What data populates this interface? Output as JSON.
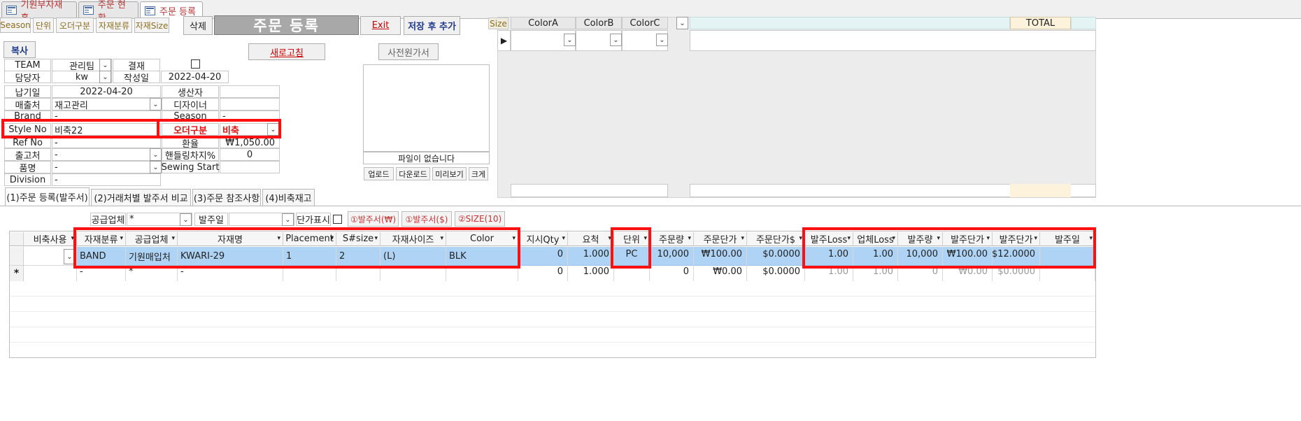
{
  "doc_tabs": [
    "기원부자재 홈",
    "주문 현황",
    "주문 등록"
  ],
  "toolbar": {
    "buttons": [
      "Season",
      "단위",
      "오더구분",
      "자재분류",
      "자재Size"
    ],
    "delete": "삭제",
    "title": "주문 등록",
    "exit": "Exit",
    "save_add": "저장 후 추가"
  },
  "copy_button": "복사",
  "refresh_button": "새로고침",
  "preview": {
    "button": "사전원가서",
    "empty": "파일이 없습니다",
    "actions": [
      "업로드",
      "다운로드",
      "미리보기",
      "크게"
    ]
  },
  "form": {
    "team_label": "TEAM",
    "team": "관리팀",
    "approval_label": "결재",
    "manager_label": "담당자",
    "manager": "kw",
    "created_label": "작성일",
    "created": "2022-04-20",
    "due_label": "납기일",
    "due": "2022-04-20",
    "producer_label": "생산자",
    "producer": "",
    "seller_label": "매출처",
    "seller": "재고관리",
    "designer_label": "디자이너",
    "designer": "",
    "brand_label": "Brand",
    "brand": "-",
    "season_label": "Season",
    "season": "-",
    "style_label": "Style No",
    "style": "비축22",
    "order_type_label": "오더구분",
    "order_type": "비축",
    "ref_label": "Ref No",
    "ref": "-",
    "exchange_label": "환율",
    "exchange": "₩1,050.00",
    "warehouse_label": "출고처",
    "warehouse": "-",
    "handling_label": "핸들링차지%",
    "handling": "0",
    "item_label": "품명",
    "item": "-",
    "sewing_label": "Sewing Start",
    "sewing": "",
    "division_label": "Division",
    "division": "-"
  },
  "size_panel": {
    "size": "Size",
    "colors": [
      "ColorA",
      "ColorB",
      "ColorC"
    ],
    "total": "TOTAL"
  },
  "subtabs": [
    "(1)주문 등록(발주서)",
    "(2)거래처별 발주서 비교",
    "(3)주문 참조사항",
    "(4)비축재고"
  ],
  "filter": {
    "supplier_label": "공급업체",
    "supplier": "*",
    "order_date_label": "발주일",
    "order_date": "",
    "price_show": "단가표시",
    "buttons": [
      "①발주서(₩)",
      "①발주서($)",
      "②SIZE(10)"
    ]
  },
  "grid": {
    "headers": [
      "비축사용",
      "자재분류",
      "공급업체",
      "자재명",
      "Placement",
      "S#size",
      "자재사이즈",
      "Color",
      "지시Qty",
      "요척",
      "단위",
      "주문량",
      "주문단가",
      "주문단가$",
      "발주Loss",
      "업체Loss",
      "발주량",
      "발주단가",
      "발주단가",
      "발주일"
    ],
    "row1": [
      "",
      "BAND",
      "기원매입처",
      "KWARI-29",
      "1",
      "2",
      "(L)",
      "BLK",
      "0",
      "1.000",
      "PC",
      "10,000",
      "₩100.00",
      "$0.0000",
      "1.00",
      "1.00",
      "10,000",
      "₩100.00",
      "$12.0000",
      ""
    ],
    "row2": [
      "",
      "-",
      "*",
      "-",
      "",
      "",
      "",
      "",
      "0",
      "1.000",
      "",
      "0",
      "₩0.00",
      "$0.0000",
      "1.00",
      "1.00",
      "0",
      "₩0.00",
      "$0.0000",
      ""
    ],
    "new_marker": "*"
  },
  "colors": {
    "highlight": "#ff1010",
    "row_selected": "#aed3f4",
    "tab_text": "#b83434"
  }
}
